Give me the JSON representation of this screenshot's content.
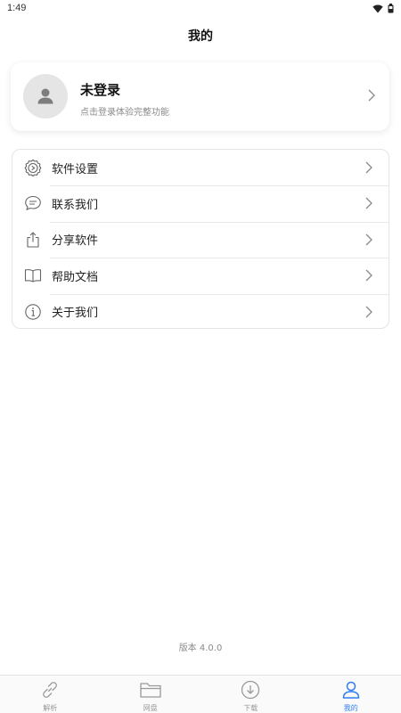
{
  "status_bar": {
    "time": "1:49"
  },
  "header": {
    "title": "我的"
  },
  "profile": {
    "name": "未登录",
    "subtitle": "点击登录体验完整功能"
  },
  "menu": [
    {
      "label": "软件设置",
      "icon": "settings-icon"
    },
    {
      "label": "联系我们",
      "icon": "chat-icon"
    },
    {
      "label": "分享软件",
      "icon": "share-icon"
    },
    {
      "label": "帮助文档",
      "icon": "book-icon"
    },
    {
      "label": "关于我们",
      "icon": "info-icon"
    }
  ],
  "footer": {
    "version": "版本 4.0.0"
  },
  "tabs": [
    {
      "label": "解析",
      "icon": "link-icon",
      "active": false
    },
    {
      "label": "网盘",
      "icon": "folder-icon",
      "active": false
    },
    {
      "label": "下载",
      "icon": "download-icon",
      "active": false
    },
    {
      "label": "我的",
      "icon": "user-icon",
      "active": true
    }
  ],
  "colors": {
    "accent": "#2f7df6",
    "muted": "#8a8a8a",
    "icon": "#666666"
  }
}
